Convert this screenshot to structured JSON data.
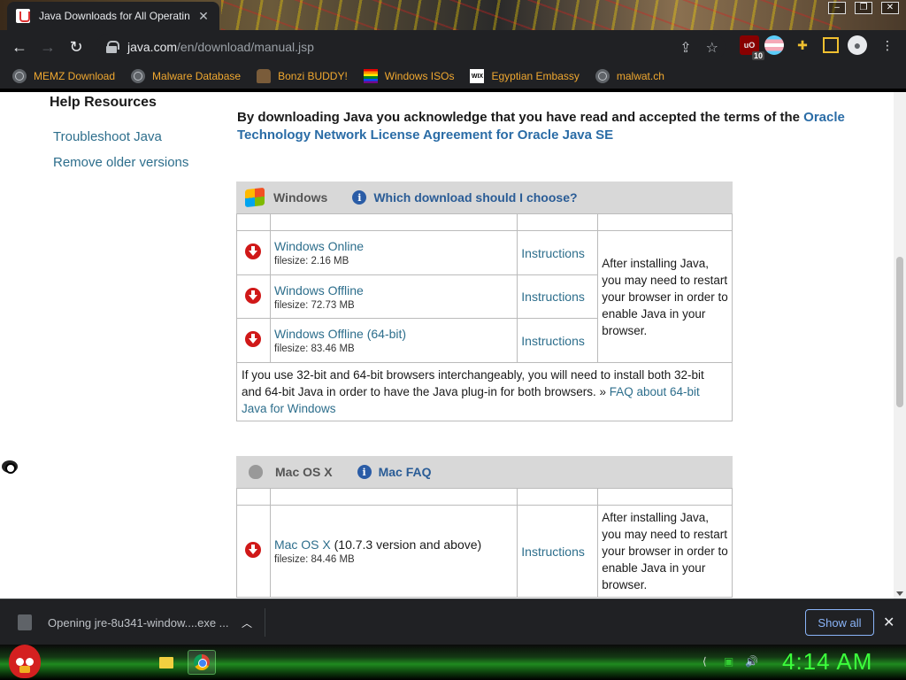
{
  "browser": {
    "tab_title": "Java Downloads for All Operatin",
    "url_host": "java.com",
    "url_path": "/en/download/manual.jsp",
    "ublock_badge": "10",
    "ublock_label": "uO"
  },
  "bookmarks": [
    {
      "label": "MEMZ Download",
      "icon": "globe-icon"
    },
    {
      "label": "Malware Database",
      "icon": "globe-icon"
    },
    {
      "label": "Bonzi BUDDY!",
      "icon": "bonzi-icon"
    },
    {
      "label": "Windows ISOs",
      "icon": "rainbow-flag-icon"
    },
    {
      "label": "Egyptian Embassy",
      "icon": "wix-icon",
      "icon_text": "WIX"
    },
    {
      "label": "malwat.ch",
      "icon": "globe-icon"
    }
  ],
  "sidebar": {
    "title": "Help Resources",
    "links": [
      "Troubleshoot Java",
      "Remove older versions"
    ]
  },
  "intro": {
    "text": "By downloading Java you acknowledge that you have read and accepted the terms of the ",
    "link": "Oracle Technology Network License Agreement for Oracle Java SE"
  },
  "windows": {
    "os_name": "Windows",
    "info_link": "Which download should I choose?",
    "downloads": [
      {
        "name": "Windows Online",
        "suffix": "",
        "filesize": "filesize: 2.16 MB",
        "instructions": "Instructions"
      },
      {
        "name": "Windows Offline",
        "suffix": "",
        "filesize": "filesize: 72.73 MB",
        "instructions": "Instructions"
      },
      {
        "name": "Windows Offline (64-bit)",
        "suffix": "",
        "filesize": "filesize: 83.46 MB",
        "instructions": "Instructions"
      }
    ],
    "after_note": "After installing Java, you may need to restart your browser in order to enable Java in your browser.",
    "bottom_note": "If you use 32-bit and 64-bit browsers interchangeably, you will need to install both 32-bit and 64-bit Java in order to have the Java plug-in for both browsers. » ",
    "bottom_link": "FAQ about 64-bit Java for Windows"
  },
  "mac": {
    "os_name": "Mac OS X",
    "info_link": "Mac FAQ",
    "download": {
      "name": "Mac OS X",
      "suffix": " (10.7.3 version and above)",
      "filesize": "filesize: 84.46 MB",
      "instructions": "Instructions"
    },
    "after_note": "After installing Java, you may need to restart your browser in order to enable Java in your browser."
  },
  "download_bar": {
    "item_text": "Opening jre-8u341-window....exe ...",
    "show_all": "Show all"
  },
  "taskbar": {
    "clock": "4:14 AM"
  },
  "colors": {
    "link": "#2d6e8c",
    "header_bg": "#d8d8d8",
    "download_red": "#d01818",
    "clock_green": "#3cff3c"
  }
}
